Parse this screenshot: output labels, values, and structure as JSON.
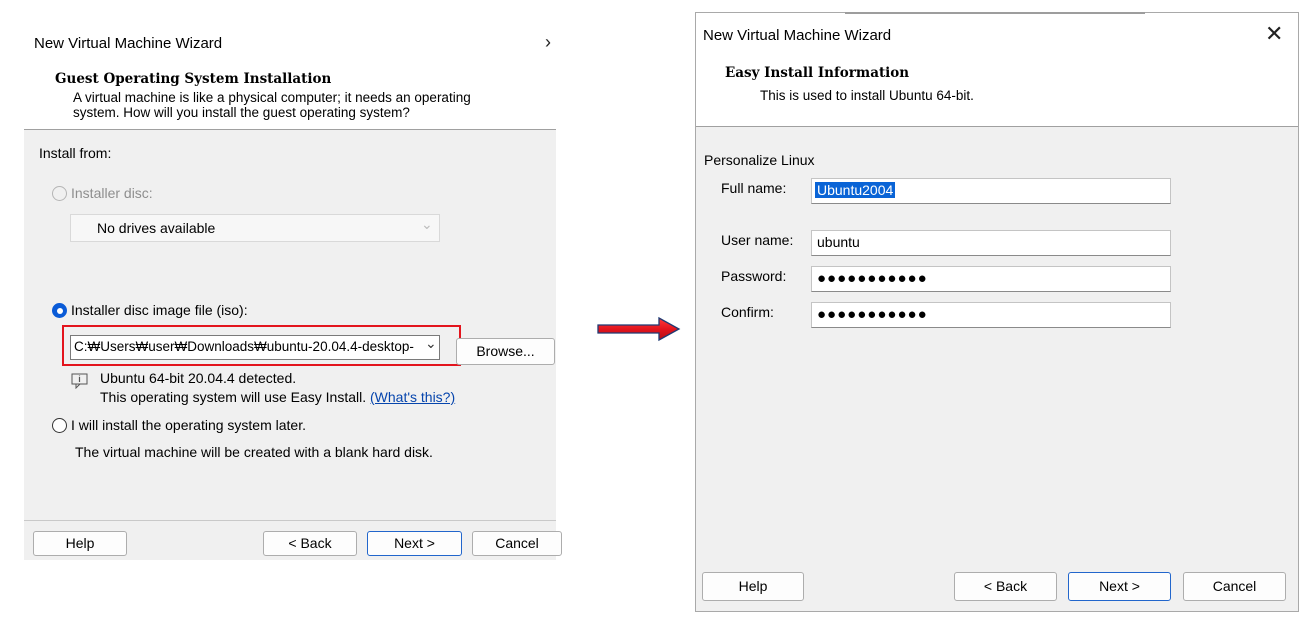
{
  "left_dialog": {
    "title": "New Virtual Machine Wizard",
    "header": {
      "title": "Guest Operating System Installation",
      "description_line1": "A virtual machine is like a physical computer; it needs an operating",
      "description_line2": "system. How will you install the guest operating system?"
    },
    "install_from_label": "Install from:",
    "options": {
      "installer_disc_label": "Installer disc:",
      "drive_combo_value": "No drives available",
      "iso_label": "Installer disc image file (iso):",
      "iso_path_value": "C:₩Users₩user₩Downloads₩ubuntu-20.04.4-desktop-",
      "browse_label": "Browse...",
      "detected_line1": "Ubuntu 64-bit 20.04.4 detected.",
      "detected_line2": "This operating system will use Easy Install.",
      "whats_this_link": "(What's this?)",
      "later_label": "I will install the operating system later.",
      "later_desc": "The virtual machine will be created with a blank hard disk."
    },
    "selected_option": "iso",
    "buttons": {
      "help": "Help",
      "back": "< Back",
      "next": "Next >",
      "cancel": "Cancel"
    }
  },
  "right_dialog": {
    "title": "New Virtual Machine Wizard",
    "close_glyph": "✕",
    "header": {
      "title": "Easy Install Information",
      "description": "This is used to install Ubuntu 64-bit."
    },
    "section_label": "Personalize Linux",
    "fields": {
      "full_name_label": "Full name:",
      "full_name_value": "Ubuntu2004",
      "user_name_label": "User name:",
      "user_name_value": "ubuntu",
      "password_label": "Password:",
      "password_value": "●●●●●●●●●●●",
      "confirm_label": "Confirm:",
      "confirm_value": "●●●●●●●●●●●"
    },
    "buttons": {
      "help": "Help",
      "back": "< Back",
      "next": "Next >",
      "cancel": "Cancel"
    }
  },
  "icons": {
    "chevron_right": "›",
    "dropdown": "⌄"
  },
  "colors": {
    "highlight_box": "#e3141d",
    "arrow": "#e3141d",
    "selection": "#0a64d6",
    "link": "#0645ad",
    "dialog_body": "#f0f0f0"
  }
}
